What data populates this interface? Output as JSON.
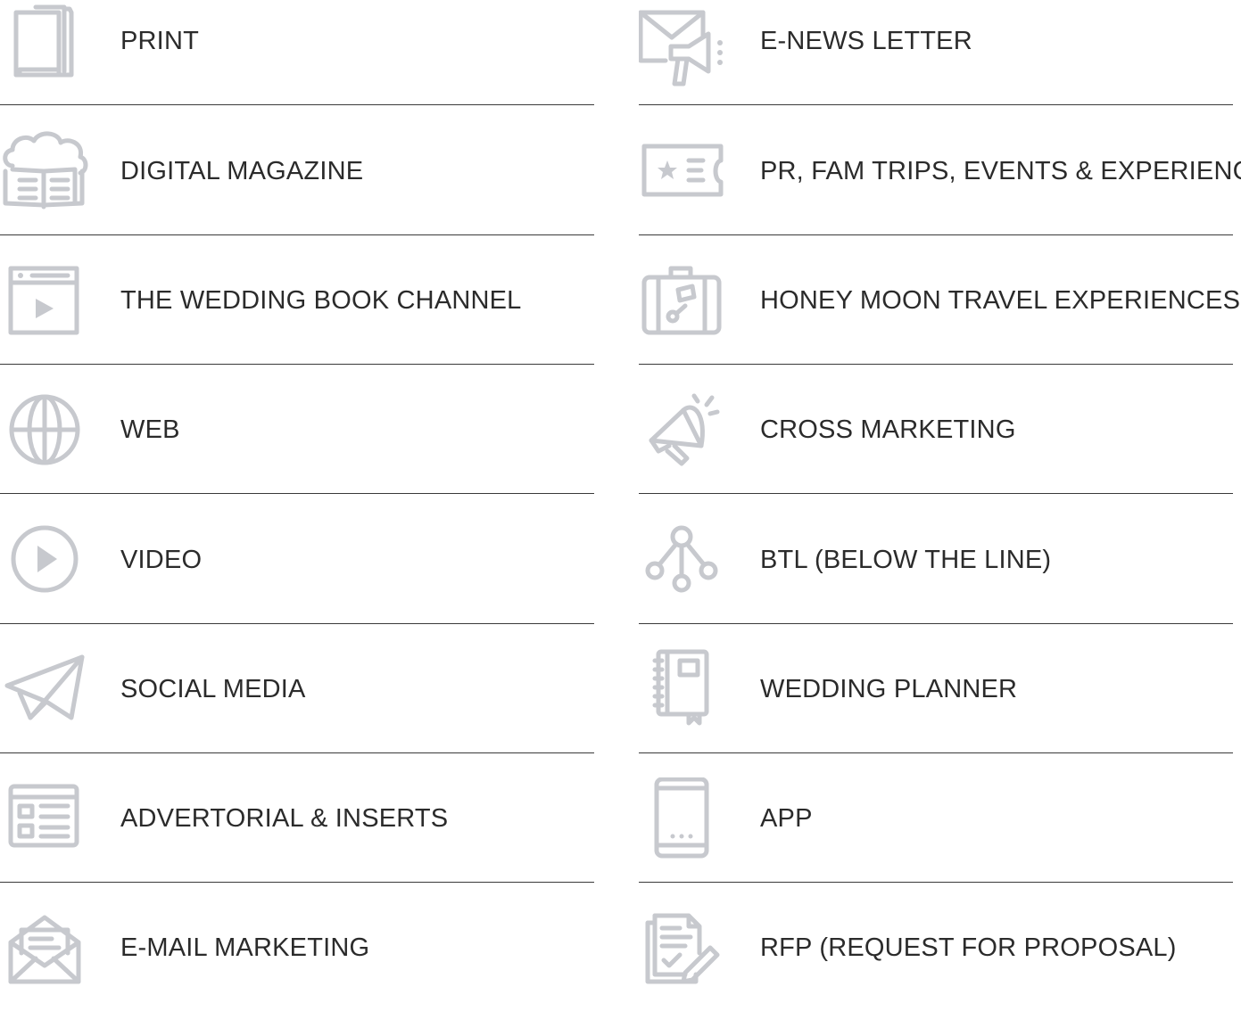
{
  "colors": {
    "icon": "#c7c9ce",
    "text": "#2b2b2b",
    "divider": "#3a3a3a"
  },
  "left": [
    {
      "icon": "book-icon",
      "label": "PRINT"
    },
    {
      "icon": "cloud-book-icon",
      "label": "DIGITAL MAGAZINE"
    },
    {
      "icon": "video-window-icon",
      "label": "THE WEDDING BOOK CHANNEL"
    },
    {
      "icon": "globe-icon",
      "label": "WEB"
    },
    {
      "icon": "play-circle-icon",
      "label": "VIDEO"
    },
    {
      "icon": "paper-plane-icon",
      "label": "SOCIAL MEDIA"
    },
    {
      "icon": "newspaper-icon",
      "label": "ADVERTORIAL & INSERTS"
    },
    {
      "icon": "open-envelope-icon",
      "label": "E-MAIL MARKETING"
    }
  ],
  "right": [
    {
      "icon": "envelope-megaphone-icon",
      "label": "E-NEWS LETTER"
    },
    {
      "icon": "ticket-icon",
      "label": "PR, FAM TRIPS, EVENTS & EXPERIENCES"
    },
    {
      "icon": "suitcase-icon",
      "label": "HONEY MOON TRAVEL EXPERIENCES"
    },
    {
      "icon": "megaphone-icon",
      "label": "CROSS MARKETING"
    },
    {
      "icon": "network-icon",
      "label": "BTL (BELOW THE LINE)"
    },
    {
      "icon": "planner-notebook-icon",
      "label": "WEDDING PLANNER"
    },
    {
      "icon": "smartphone-icon",
      "label": "APP"
    },
    {
      "icon": "document-pen-icon",
      "label": "RFP (REQUEST FOR PROPOSAL)"
    }
  ]
}
